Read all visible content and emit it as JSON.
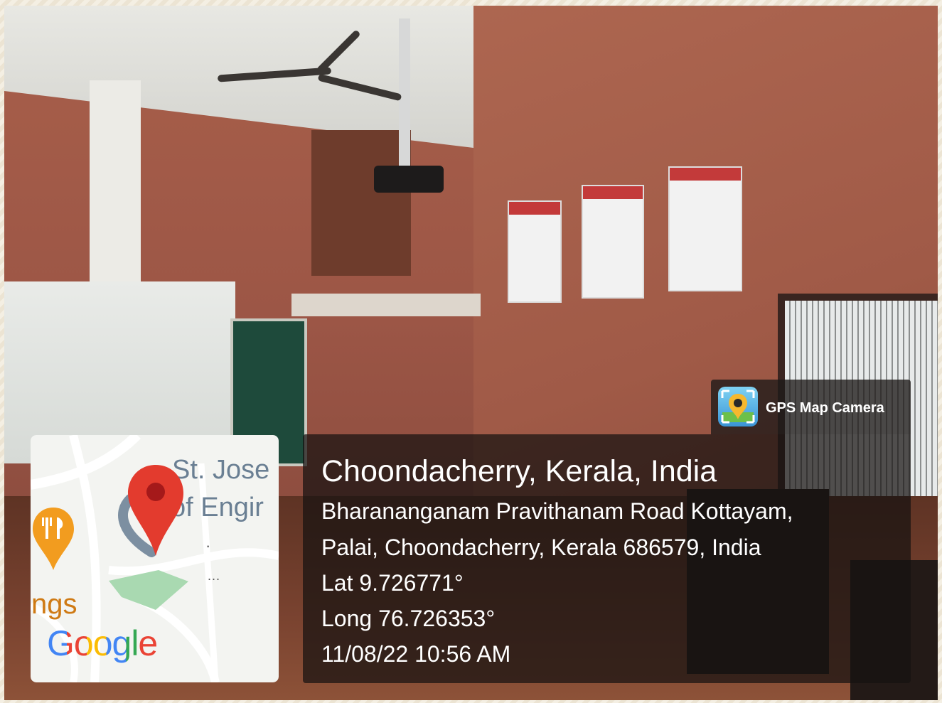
{
  "map": {
    "poi_line1": "St. Jose",
    "poi_line2": "of Engir",
    "edge_label": "ngs",
    "more_dots": "...",
    "attribution": "Google",
    "pin_color": "#e33b2e",
    "restaurant_pin_color": "#f29c1f",
    "icons": {
      "location_pin": "location-pin-icon",
      "restaurant": "restaurant-icon",
      "place_marker": "place-marker-icon"
    }
  },
  "badge": {
    "app_name": "GPS Map Camera",
    "icon": "gps-map-camera-app-icon"
  },
  "location": {
    "place": "Choondacherry, Kerala, India",
    "address_line1": "Bharananganam Pravithanam Road Kottayam,",
    "address_line2": "Palai, Choondacherry, Kerala 686579, India",
    "latitude": "Lat 9.726771°",
    "longitude": "Long 76.726353°",
    "datetime": "11/08/22 10:56 AM"
  }
}
